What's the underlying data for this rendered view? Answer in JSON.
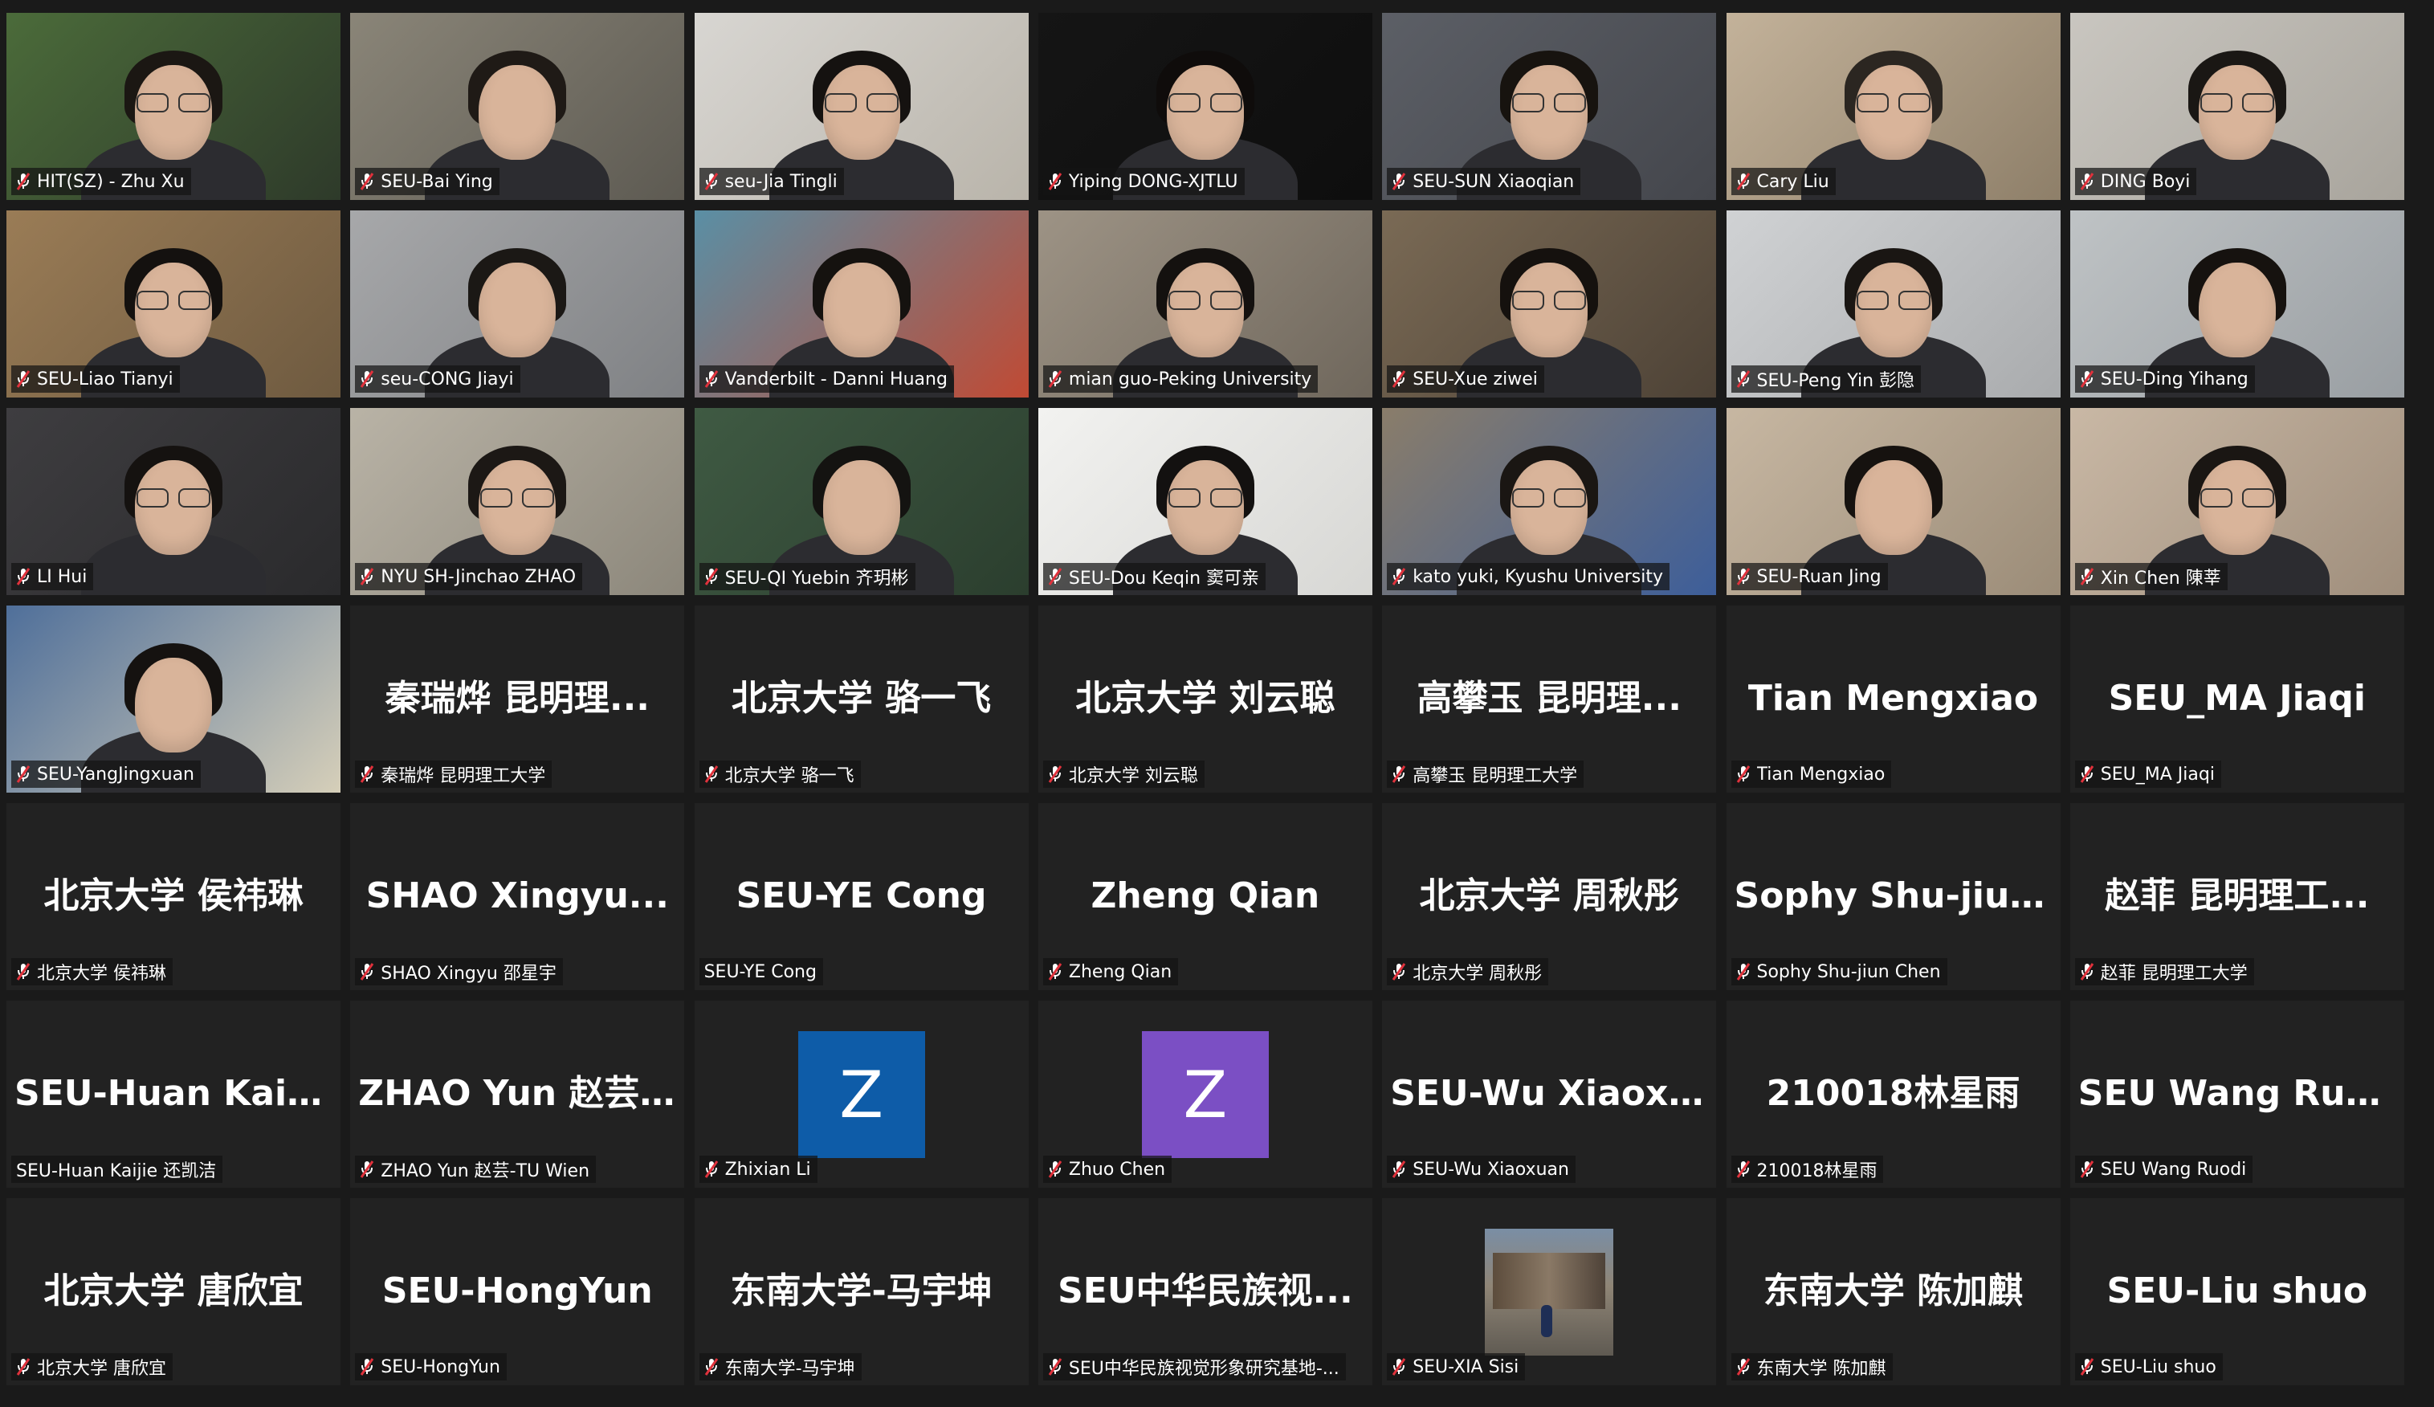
{
  "participants": [
    {
      "label": "HIT(SZ) - Zhu Xu",
      "video": true,
      "bg": "#4b6b3a",
      "accent": "#2e3a2a",
      "hair": "#1b1713",
      "glasses": true
    },
    {
      "label": "SEU-Bai Ying",
      "video": true,
      "bg": "#8a8578",
      "accent": "#5d5a52",
      "hair": "#1f1a16",
      "glasses": false
    },
    {
      "label": "seu-Jia Tingli",
      "video": true,
      "bg": "#d8d6d2",
      "accent": "#b9b4aa",
      "hair": "#151210",
      "glasses": true
    },
    {
      "label": "Yiping DONG-XJTLU",
      "video": true,
      "bg": "#151515",
      "accent": "#0e0e0e",
      "hair": "#0f0c0b",
      "glasses": true
    },
    {
      "label": "SEU-SUN Xiaoqian",
      "video": true,
      "bg": "#5c5f66",
      "accent": "#44464c",
      "hair": "#17130f",
      "glasses": true
    },
    {
      "label": "Cary Liu",
      "video": true,
      "bg": "#c3b29a",
      "accent": "#8e7f69",
      "hair": "#2b2621",
      "glasses": true
    },
    {
      "label": "DING Boyi",
      "video": true,
      "bg": "#c9c6c0",
      "accent": "#a8a49c",
      "hair": "#1a1714",
      "glasses": true
    },
    {
      "label": "SEU-Liao Tianyi",
      "video": true,
      "bg": "#9a7c56",
      "accent": "#6e5a40",
      "hair": "#14110f",
      "glasses": true
    },
    {
      "label": "seu-CONG Jiayi",
      "video": true,
      "bg": "#a7a8aa",
      "accent": "#7f8184",
      "hair": "#1b1815",
      "glasses": false
    },
    {
      "label": "Vanderbilt - Danni Huang",
      "video": true,
      "bg": "#5a8fa5",
      "accent": "#c04a34",
      "hair": "#15120f",
      "glasses": false
    },
    {
      "label": "mian guo-Peking University",
      "video": true,
      "bg": "#9d9385",
      "accent": "#6f675c",
      "hair": "#14110f",
      "glasses": true
    },
    {
      "label": "SEU-Xue ziwei",
      "video": true,
      "bg": "#7a6a55",
      "accent": "#4d4236",
      "hair": "#15110e",
      "glasses": true
    },
    {
      "label": "SEU-Peng Yin 彭隐",
      "video": true,
      "bg": "#d0d2d4",
      "accent": "#a9abad",
      "hair": "#1a1613",
      "glasses": true
    },
    {
      "label": "SEU-Ding Yihang",
      "video": true,
      "bg": "#bfc3c5",
      "accent": "#999ea2",
      "hair": "#16120f",
      "glasses": false
    },
    {
      "label": "LI Hui",
      "video": true,
      "bg": "#3e3d40",
      "accent": "#2a2a2c",
      "hair": "#151210",
      "glasses": true
    },
    {
      "label": "NYU SH-Jinchao ZHAO",
      "video": true,
      "bg": "#b9b3a6",
      "accent": "#8c877b",
      "hair": "#1c1815",
      "glasses": true
    },
    {
      "label": "SEU-QI Yuebin 齐玥彬",
      "video": true,
      "bg": "#3f5a43",
      "accent": "#2b3e2e",
      "hair": "#141311",
      "glasses": false
    },
    {
      "label": "SEU-Dou Keqin 窦可亲",
      "video": true,
      "bg": "#f2f2f0",
      "accent": "#d7d7d4",
      "hair": "#131110",
      "glasses": true
    },
    {
      "label": "kato yuki, Kyushu University",
      "video": true,
      "bg": "#8a7d6a",
      "accent": "#3d5e9a",
      "hair": "#1a1613",
      "glasses": true
    },
    {
      "label": "SEU-Ruan Jing",
      "video": true,
      "bg": "#c7b7a2",
      "accent": "#9b8c78",
      "hair": "#16120f",
      "glasses": false
    },
    {
      "label": "Xin Chen 陳莘",
      "video": true,
      "bg": "#c9b8a5",
      "accent": "#9f8e7c",
      "hair": "#1a1613",
      "glasses": true
    },
    {
      "label": "SEU-YangJingxuan",
      "video": true,
      "bg": "#4f6f9a",
      "accent": "#d6cfb9",
      "hair": "#151210",
      "glasses": false
    },
    {
      "label": "秦瑞烨 昆明理工大学",
      "name": "秦瑞烨 昆明理...",
      "video": false
    },
    {
      "label": "北京大学 骆一飞",
      "name": "北京大学 骆一飞",
      "video": false
    },
    {
      "label": "北京大学 刘云聪",
      "name": "北京大学 刘云聪",
      "video": false
    },
    {
      "label": "高攀玉 昆明理工大学",
      "name": "高攀玉 昆明理...",
      "video": false
    },
    {
      "label": "Tian Mengxiao",
      "name": "Tian Mengxiao",
      "video": false
    },
    {
      "label": "SEU_MA Jiaqi",
      "name": "SEU_MA Jiaqi",
      "video": false
    },
    {
      "label": "北京大学 侯祎琳",
      "name": "北京大学 侯祎琳",
      "video": false
    },
    {
      "label": "SHAO Xingyu 邵星宇",
      "name": "SHAO Xingyu...",
      "video": false
    },
    {
      "label": "SEU-YE Cong",
      "name": "SEU-YE Cong",
      "video": false,
      "nomic": true
    },
    {
      "label": "Zheng Qian",
      "name": "Zheng Qian",
      "video": false
    },
    {
      "label": "北京大学 周秋彤",
      "name": "北京大学 周秋彤",
      "video": false
    },
    {
      "label": "Sophy Shu-jiun Chen",
      "name": "Sophy Shu-jiun...",
      "video": false
    },
    {
      "label": "赵菲 昆明理工大学",
      "name": "赵菲 昆明理工...",
      "video": false
    },
    {
      "label": "SEU-Huan Kaijie 还凯洁",
      "name": "SEU-Huan Kaijie...",
      "video": false,
      "nomic": true
    },
    {
      "label": "ZHAO Yun 赵芸-TU Wien",
      "name": "ZHAO Yun 赵芸-...",
      "video": false
    },
    {
      "label": "Zhixian Li",
      "avatar": "Z",
      "avatar_color": "#0e5ca8",
      "video": false
    },
    {
      "label": "Zhuo Chen",
      "avatar": "Z",
      "avatar_color": "#7b4fc4",
      "video": false
    },
    {
      "label": "SEU-Wu Xiaoxuan",
      "name": "SEU-Wu Xiaoxuan",
      "video": false
    },
    {
      "label": "210018林星雨",
      "name": "210018林星雨",
      "video": false
    },
    {
      "label": "SEU Wang Ruodi",
      "name": "SEU Wang Ruodi",
      "video": false
    },
    {
      "label": "北京大学 唐欣宜",
      "name": "北京大学 唐欣宜",
      "video": false
    },
    {
      "label": "SEU-HongYun",
      "name": "SEU-HongYun",
      "video": false
    },
    {
      "label": "东南大学-马宇坤",
      "name": "东南大学-马宇坤",
      "video": false
    },
    {
      "label": "SEU中华民族视觉形象研究基地-...",
      "name": "SEU中华民族视...",
      "video": false
    },
    {
      "label": "SEU-XIA Sisi",
      "thumb": true,
      "video": false
    },
    {
      "label": "东南大学 陈加麒",
      "name": "东南大学 陈加麒",
      "video": false
    },
    {
      "label": "SEU-Liu shuo",
      "name": "SEU-Liu shuo",
      "video": false
    }
  ],
  "colors": {
    "background": "#1a1a1a",
    "tile": "#222222",
    "muted_icon": "#e0323c",
    "text": "#ffffff"
  }
}
